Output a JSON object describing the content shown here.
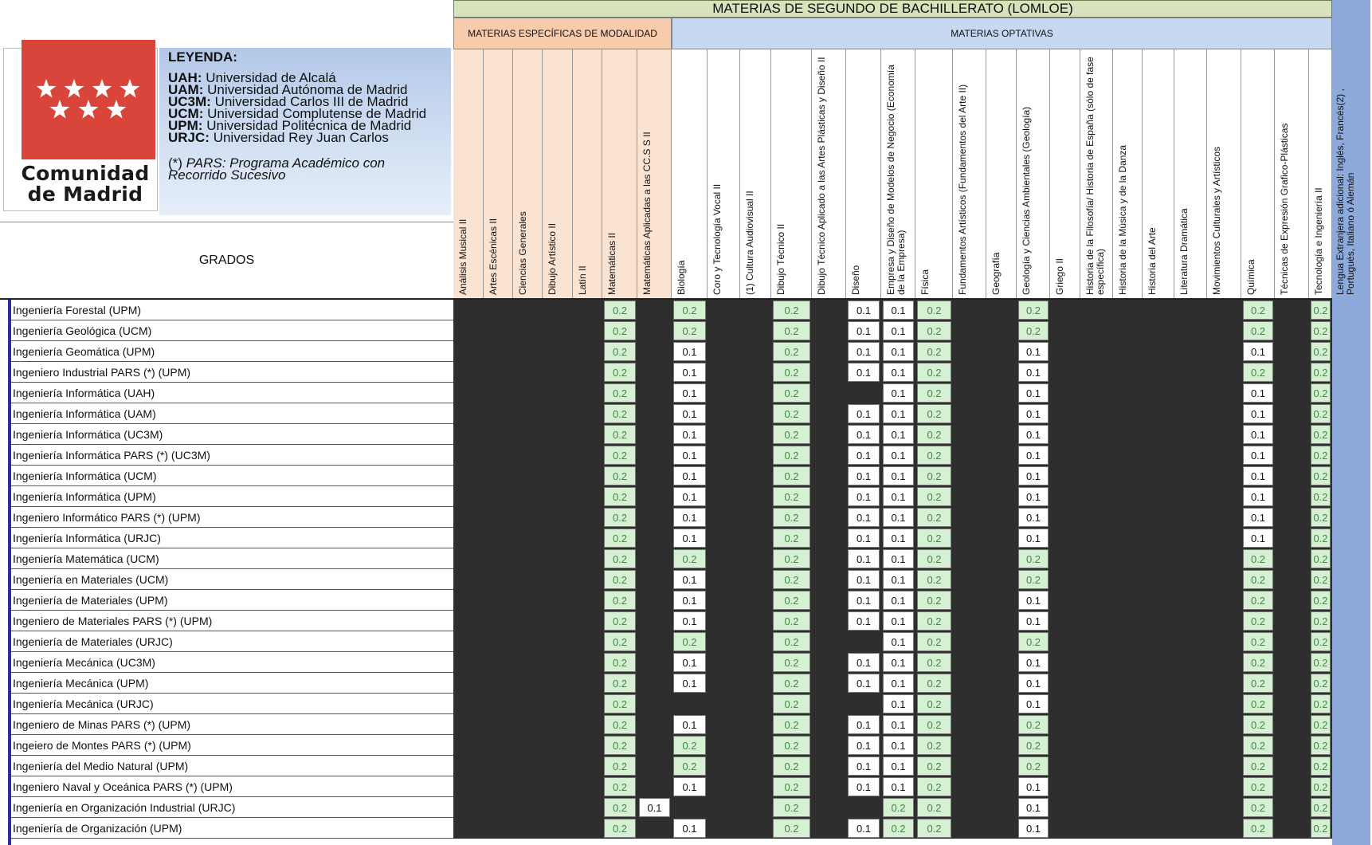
{
  "header": {
    "title": "MATERIAS DE SEGUNDO DE BACHILLERATO (LOMLOE)",
    "group_modalidad": "MATERIAS ESPECÍFICAS DE MODALIDAD",
    "group_optativas": "MATERIAS OPTATIVAS",
    "grados_label": "GRADOS"
  },
  "logo": {
    "line1": "Comunidad",
    "line2": "de Madrid"
  },
  "legend": {
    "title": "LEYENDA:",
    "items": [
      {
        "abbr": "UAH:",
        "text": "Universidad de Alcalá"
      },
      {
        "abbr": "UAM:",
        "text": "Universidad Autónoma de Madrid"
      },
      {
        "abbr": "UC3M:",
        "text": "Universidad Carlos III de Madrid"
      },
      {
        "abbr": "UCM:",
        "text": "Universidad Complutense de Madrid"
      },
      {
        "abbr": "UPM:",
        "text": "Universidad Politécnica de Madrid"
      },
      {
        "abbr": "URJC:",
        "text": "Universidad Rey Juan Carlos"
      }
    ],
    "note_prefix": "(*) ",
    "note_line1": "PARS: Programa Académico con",
    "note_line2": "Recorrido Sucesivo"
  },
  "columns": [
    "Análisis Musical II",
    "Artes Escénicas II",
    "Ciencias Generales",
    "Dibujo Artístico II",
    "Latín II",
    "Matemáticas II",
    "Matemáticas Aplicadas a las CC.S S II",
    "Biología",
    "Coro y Tecnología Vocal II",
    "(1) Cultura Audiovisual II",
    "Dibujo Técnico II",
    "Dibujo Técnico Aplicado a las Artes Plásticas y Diseño II",
    "Diseño",
    "Empresa y Diseño de Modelos de Negocio (Economía de la Empresa)",
    "Física",
    "Fundamentos Artísticos (Fundamentos del Arte II)",
    "Geografía",
    "Geología y Ciencias Ambientales (Geología)",
    "Griego II",
    "Historia de la Filosofía/ Historia de España (sólo de fase específica)",
    "Historia de la Música y de la Danza",
    "Historia del Arte",
    "Literatura Dramática",
    "Movimientos Culturales y Artísticos",
    "Química",
    "Técnicas de Expresión Grafico-Plásticas",
    "Tecnología e Ingeniería II"
  ],
  "last_column": "Lengua Extranjera adicional: Inglés, Francés(2) , Portugués, Italiano ó Alemán",
  "rows": [
    {
      "name": "Ingeniería Forestal (UPM)",
      "v": {
        "5": "0.2",
        "7": "0.2",
        "10": "0.2",
        "12": "0.1",
        "13": "0.1",
        "14": "0.2",
        "17": "0.2",
        "24": "0.2",
        "26": "0.2"
      }
    },
    {
      "name": "Ingeniería Geológica (UCM)",
      "v": {
        "5": "0.2",
        "7": "0.2",
        "10": "0.2",
        "12": "0.1",
        "13": "0.1",
        "14": "0.2",
        "17": "0.2",
        "24": "0.2",
        "26": "0.2"
      }
    },
    {
      "name": "Ingeniería Geomática (UPM)",
      "v": {
        "5": "0.2",
        "7": "0.1",
        "10": "0.2",
        "12": "0.1",
        "13": "0.1",
        "14": "0.2",
        "17": "0.1",
        "24": "0.1",
        "26": "0.2"
      }
    },
    {
      "name": "Ingeniero Industrial PARS (*) (UPM)",
      "v": {
        "5": "0.2",
        "7": "0.1",
        "10": "0.2",
        "12": "0.1",
        "13": "0.1",
        "14": "0.2",
        "17": "0.1",
        "24": "0.2",
        "26": "0.2"
      }
    },
    {
      "name": "Ingeniería Informática (UAH)",
      "v": {
        "5": "0.2",
        "7": "0.1",
        "10": "0.2",
        "13": "0.1",
        "14": "0.2",
        "17": "0.1",
        "24": "0.1",
        "26": "0.2"
      }
    },
    {
      "name": "Ingeniería Informática (UAM)",
      "v": {
        "5": "0.2",
        "7": "0.1",
        "10": "0.2",
        "12": "0.1",
        "13": "0.1",
        "14": "0.2",
        "17": "0.1",
        "24": "0.1",
        "26": "0.2"
      }
    },
    {
      "name": "Ingeniería Informática (UC3M)",
      "v": {
        "5": "0.2",
        "7": "0.1",
        "10": "0.2",
        "12": "0.1",
        "13": "0.1",
        "14": "0.2",
        "17": "0.1",
        "24": "0.1",
        "26": "0.2"
      }
    },
    {
      "name": "Ingeniería Informática PARS (*) (UC3M)",
      "v": {
        "5": "0.2",
        "7": "0.1",
        "10": "0.2",
        "12": "0.1",
        "13": "0.1",
        "14": "0.2",
        "17": "0.1",
        "24": "0.1",
        "26": "0.2"
      }
    },
    {
      "name": "Ingeniería Informática (UCM)",
      "v": {
        "5": "0.2",
        "7": "0.1",
        "10": "0.2",
        "12": "0.1",
        "13": "0.1",
        "14": "0.2",
        "17": "0.1",
        "24": "0.1",
        "26": "0.2"
      }
    },
    {
      "name": "Ingeniería Informática (UPM)",
      "v": {
        "5": "0.2",
        "7": "0.1",
        "10": "0.2",
        "12": "0.1",
        "13": "0.1",
        "14": "0.2",
        "17": "0.1",
        "24": "0.1",
        "26": "0.2"
      }
    },
    {
      "name": "Ingeniero Informático PARS (*) (UPM)",
      "v": {
        "5": "0.2",
        "7": "0.1",
        "10": "0.2",
        "12": "0.1",
        "13": "0.1",
        "14": "0.2",
        "17": "0.1",
        "24": "0.1",
        "26": "0.2"
      }
    },
    {
      "name": "Ingeniería Informática (URJC)",
      "v": {
        "5": "0.2",
        "7": "0.1",
        "10": "0.2",
        "12": "0.1",
        "13": "0.1",
        "14": "0.2",
        "17": "0.1",
        "24": "0.1",
        "26": "0.2"
      }
    },
    {
      "name": "Ingeniería Matemática (UCM)",
      "v": {
        "5": "0.2",
        "7": "0.2",
        "10": "0.2",
        "12": "0.1",
        "13": "0.1",
        "14": "0.2",
        "17": "0.2",
        "24": "0.2",
        "26": "0.2"
      }
    },
    {
      "name": "Ingeniería en Materiales (UCM)",
      "v": {
        "5": "0.2",
        "7": "0.1",
        "10": "0.2",
        "12": "0.1",
        "13": "0.1",
        "14": "0.2",
        "17": "0.2",
        "24": "0.2",
        "26": "0.2"
      }
    },
    {
      "name": "Ingeniería de Materiales (UPM)",
      "v": {
        "5": "0.2",
        "7": "0.1",
        "10": "0.2",
        "12": "0.1",
        "13": "0.1",
        "14": "0.2",
        "17": "0.1",
        "24": "0.2",
        "26": "0.2"
      }
    },
    {
      "name": "Ingeniero de Materiales PARS (*) (UPM)",
      "v": {
        "5": "0.2",
        "7": "0.1",
        "10": "0.2",
        "12": "0.1",
        "13": "0.1",
        "14": "0.2",
        "17": "0.1",
        "24": "0.2",
        "26": "0.2"
      }
    },
    {
      "name": "Ingeniería de Materiales (URJC)",
      "v": {
        "5": "0.2",
        "7": "0.2",
        "10": "0.2",
        "13": "0.1",
        "14": "0.2",
        "17": "0.2",
        "24": "0.2",
        "26": "0.2"
      }
    },
    {
      "name": "Ingeniería Mecánica (UC3M)",
      "v": {
        "5": "0.2",
        "7": "0.1",
        "10": "0.2",
        "12": "0.1",
        "13": "0.1",
        "14": "0.2",
        "17": "0.1",
        "24": "0.2",
        "26": "0.2"
      }
    },
    {
      "name": "Ingeniería Mecánica (UPM)",
      "v": {
        "5": "0.2",
        "7": "0.1",
        "10": "0.2",
        "12": "0.1",
        "13": "0.1",
        "14": "0.2",
        "17": "0.1",
        "24": "0.2",
        "26": "0.2"
      }
    },
    {
      "name": "Ingeniería Mecánica (URJC)",
      "v": {
        "5": "0.2",
        "10": "0.2",
        "13": "0.1",
        "14": "0.2",
        "17": "0.1",
        "24": "0.2",
        "26": "0.2"
      }
    },
    {
      "name": "Ingeniero de Minas PARS (*) (UPM)",
      "v": {
        "5": "0.2",
        "7": "0.1",
        "10": "0.2",
        "12": "0.1",
        "13": "0.1",
        "14": "0.2",
        "17": "0.2",
        "24": "0.2",
        "26": "0.2"
      }
    },
    {
      "name": "Ingeiero de Montes PARS (*) (UPM)",
      "v": {
        "5": "0.2",
        "7": "0.2",
        "10": "0.2",
        "12": "0.1",
        "13": "0.1",
        "14": "0.2",
        "17": "0.2",
        "24": "0.2",
        "26": "0.2"
      }
    },
    {
      "name": "Ingeniería del Medio Natural (UPM)",
      "v": {
        "5": "0.2",
        "7": "0.2",
        "10": "0.2",
        "12": "0.1",
        "13": "0.1",
        "14": "0.2",
        "17": "0.2",
        "24": "0.2",
        "26": "0.2"
      }
    },
    {
      "name": "Ingeniero Naval y Oceánica PARS (*) (UPM)",
      "v": {
        "5": "0.2",
        "7": "0.1",
        "10": "0.2",
        "12": "0.1",
        "13": "0.1",
        "14": "0.2",
        "17": "0.1",
        "24": "0.2",
        "26": "0.2"
      }
    },
    {
      "name": "Ingeniería en Organización Industrial (URJC)",
      "v": {
        "5": "0.2",
        "6": "0.1",
        "10": "0.2",
        "13": "0.2",
        "14": "0.2",
        "17": "0.1",
        "24": "0.2",
        "26": "0.2"
      }
    },
    {
      "name": "Ingeniería de Organización (UPM)",
      "v": {
        "5": "0.2",
        "7": "0.1",
        "10": "0.2",
        "12": "0.1",
        "13": "0.2",
        "14": "0.2",
        "17": "0.1",
        "24": "0.2",
        "26": "0.2"
      }
    }
  ],
  "colors": {
    "green_fill": "#d5f0d3",
    "green_text": "#3d8b3d",
    "modalidad_header": "#f8cbad",
    "optativas_header": "#c6d9f1",
    "title_bar": "#d6e3bc",
    "dark_cell": "#2e2e2e"
  }
}
